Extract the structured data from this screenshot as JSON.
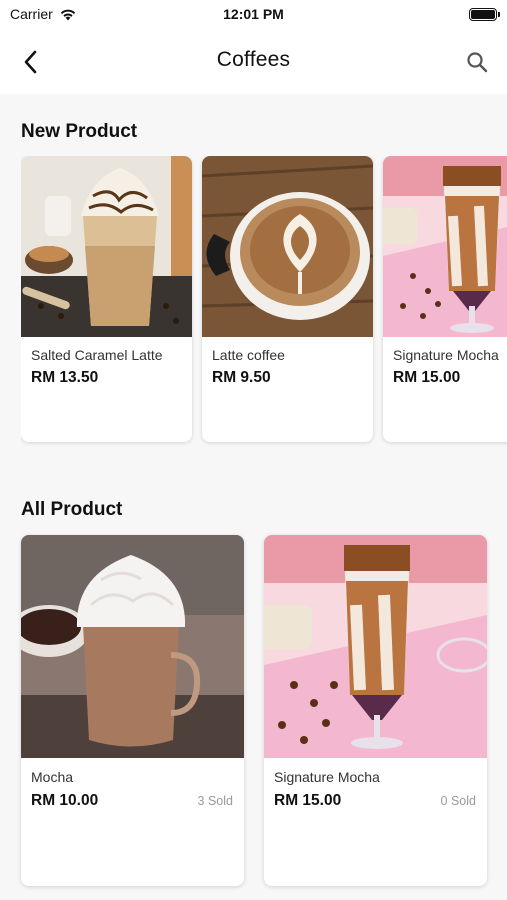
{
  "status_bar": {
    "carrier": "Carrier",
    "time": "12:01 PM"
  },
  "navbar": {
    "title": "Coffees",
    "back_icon": "chevron-left-icon",
    "search_icon": "search-icon"
  },
  "new_product": {
    "title": "New Product",
    "items": [
      {
        "name": "Salted Caramel Latte",
        "price": "RM 13.50",
        "image": "salted-caramel-latte-photo"
      },
      {
        "name": "Latte coffee",
        "price": "RM 9.50",
        "image": "latte-art-photo"
      },
      {
        "name": "Signature Mocha",
        "price": "RM 15.00",
        "image": "iced-mocha-photo"
      }
    ]
  },
  "all_product": {
    "title": "All Product",
    "items": [
      {
        "name": "Mocha",
        "price": "RM 10.00",
        "sold": "3 Sold",
        "image": "hot-mocha-photo"
      },
      {
        "name": "Signature Mocha",
        "price": "RM 15.00",
        "sold": "0 Sold",
        "image": "iced-mocha-photo"
      }
    ]
  },
  "colors": {
    "background": "#f7f7f7",
    "card": "#ffffff",
    "text": "#111111",
    "muted": "#9a9a9a"
  }
}
